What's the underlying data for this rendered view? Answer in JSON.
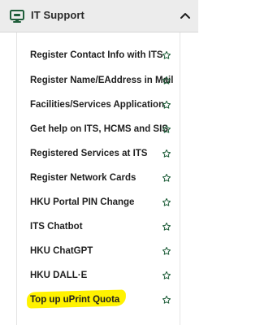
{
  "colors": {
    "header_bg": "#ececec",
    "text": "#1f1f1f",
    "icon": "#1f5e3a",
    "highlight": "#fff200"
  },
  "section": {
    "title": "IT Support",
    "icon": "monitor-icon",
    "collapse_icon": "chevron-up-icon",
    "expanded": true
  },
  "links": [
    {
      "label": "Register Contact Info with ITS",
      "icon": "star-outline-icon"
    },
    {
      "label": "Register Name/EAddress in Mail",
      "icon": "star-outline-icon"
    },
    {
      "label": "Facilities/Services Application",
      "icon": "star-outline-icon"
    },
    {
      "label": "Get help on ITS, HCMS and SIS",
      "icon": "star-outline-icon"
    },
    {
      "label": "Registered Services at ITS",
      "icon": "star-outline-icon"
    },
    {
      "label": "Register Network Cards",
      "icon": "star-outline-icon"
    },
    {
      "label": "HKU Portal PIN Change",
      "icon": "star-outline-icon"
    },
    {
      "label": "ITS Chatbot",
      "icon": "star-outline-icon"
    },
    {
      "label": "HKU ChatGPT",
      "icon": "star-outline-icon"
    },
    {
      "label": "HKU DALL·E",
      "icon": "star-outline-icon"
    },
    {
      "label": "Top up uPrint Quota",
      "icon": "star-outline-icon",
      "highlighted": true
    }
  ]
}
